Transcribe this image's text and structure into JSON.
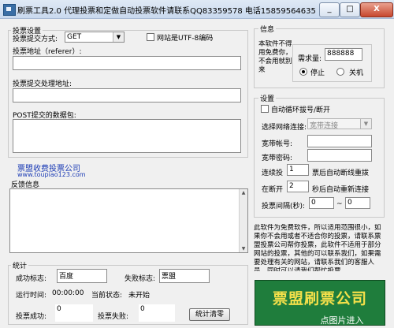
{
  "window": {
    "title": "刷票工具2.0   代理投票和定做自动投票软件请联系QQ83359578 电话15859564635",
    "minimize": "_",
    "maximize": "□",
    "close": "X"
  },
  "vote_settings": {
    "group_label": "投票设置",
    "method_label": "投票提交方式:",
    "method_value": "GET",
    "utf8_label": "网站是UTF-8编码",
    "referer_label": "投票地址（referer）:",
    "handler_label": "投票提交处理地址:",
    "packet_label": "POST提交的数据包:"
  },
  "promo": {
    "line1": "票盟收费投票公司",
    "line2": "www.toupiao123.com"
  },
  "feedback": {
    "label": "反馈信息"
  },
  "stats": {
    "group_label": "统计",
    "success_flag_label": "成功标志:",
    "success_flag_value": "百度",
    "fail_flag_label": "失败标志:",
    "fail_flag_value": "票盟",
    "runtime_label": "运行时间:",
    "runtime_value": "00:00:00",
    "status_label": "当前状态:",
    "status_value": "未开始",
    "vote_success_label": "投票成功:",
    "vote_success_value": "0",
    "vote_fail_label": "投票失败:",
    "vote_fail_value": "0",
    "clear_button": "统计清零"
  },
  "info": {
    "group_label": "信息",
    "notice": "本软件不得用免费你，不会用就别来",
    "need_label": "需求量:",
    "need_value": "888888",
    "stop_label": "停止",
    "shutdown_label": "关机"
  },
  "settings": {
    "group_label": "设置",
    "loop_label": "自动循环拔号/断开",
    "network_label": "选择网络连接:",
    "network_value": "宽带连接",
    "account_label": "宽带帐号:",
    "password_label": "宽带密码:",
    "connect_vote_label": "连续投",
    "connect_vote_value": "1",
    "connect_vote_suffix": "票后自动断线重拨",
    "reconnect_label": "在断开",
    "reconnect_value": "2",
    "reconnect_suffix": "秒后自动重新连接",
    "interval_label": "投票间隔(秒):",
    "interval_min": "0",
    "interval_sep": "~",
    "interval_max": "0"
  },
  "disclaimer": "此软件为免费软件，所以适用范围很小，如果你不会用或者不适合你的投票，请联系票盟投票公司帮你投票，此软件不适用于部分网站的投票，其他的可以联系我们，如果需要处理有关的网站，请联系我们的客服人员，同时可以请我们帮忙投票",
  "ad": {
    "title": "票盟刷票公司",
    "subtitle": "点图片进入"
  },
  "colors": {
    "ad_background": "#1f7d3c",
    "ad_title": "#f4e04a",
    "link": "#1b3bb5"
  }
}
